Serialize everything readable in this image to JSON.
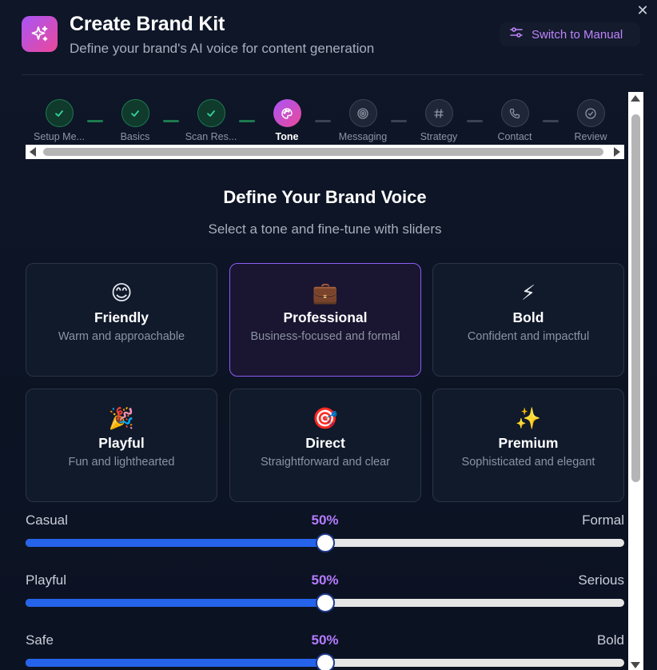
{
  "header": {
    "title": "Create Brand Kit",
    "subtitle": "Define your brand's AI voice for content generation",
    "switch_label": "Switch to Manual",
    "close_label": "✕"
  },
  "steps": [
    {
      "label": "Setup Me...",
      "state": "done"
    },
    {
      "label": "Basics",
      "state": "done"
    },
    {
      "label": "Scan Res...",
      "state": "done"
    },
    {
      "label": "Tone",
      "state": "active"
    },
    {
      "label": "Messaging",
      "state": "todo"
    },
    {
      "label": "Strategy",
      "state": "todo"
    },
    {
      "label": "Contact",
      "state": "todo"
    },
    {
      "label": "Review",
      "state": "todo"
    }
  ],
  "section": {
    "title": "Define Your Brand Voice",
    "subtitle": "Select a tone and fine-tune with sliders"
  },
  "tones": [
    {
      "emoji": "😊",
      "title": "Friendly",
      "desc": "Warm and approachable",
      "selected": false
    },
    {
      "emoji": "💼",
      "title": "Professional",
      "desc": "Business-focused and formal",
      "selected": true
    },
    {
      "emoji": "⚡",
      "title": "Bold",
      "desc": "Confident and impactful",
      "selected": false
    },
    {
      "emoji": "🎉",
      "title": "Playful",
      "desc": "Fun and lighthearted",
      "selected": false
    },
    {
      "emoji": "🎯",
      "title": "Direct",
      "desc": "Straightforward and clear",
      "selected": false
    },
    {
      "emoji": "✨",
      "title": "Premium",
      "desc": "Sophisticated and elegant",
      "selected": false
    }
  ],
  "sliders": [
    {
      "left": "Casual",
      "right": "Formal",
      "value_label": "50%",
      "value": 0.5
    },
    {
      "left": "Playful",
      "right": "Serious",
      "value_label": "50%",
      "value": 0.5
    },
    {
      "left": "Safe",
      "right": "Bold",
      "value_label": "50%",
      "value": 0.5
    }
  ],
  "colors": {
    "accent": "#a855f7",
    "accent_pink": "#ec4899",
    "done_green": "#1d7a4f",
    "slider_fill": "#2563eb"
  }
}
